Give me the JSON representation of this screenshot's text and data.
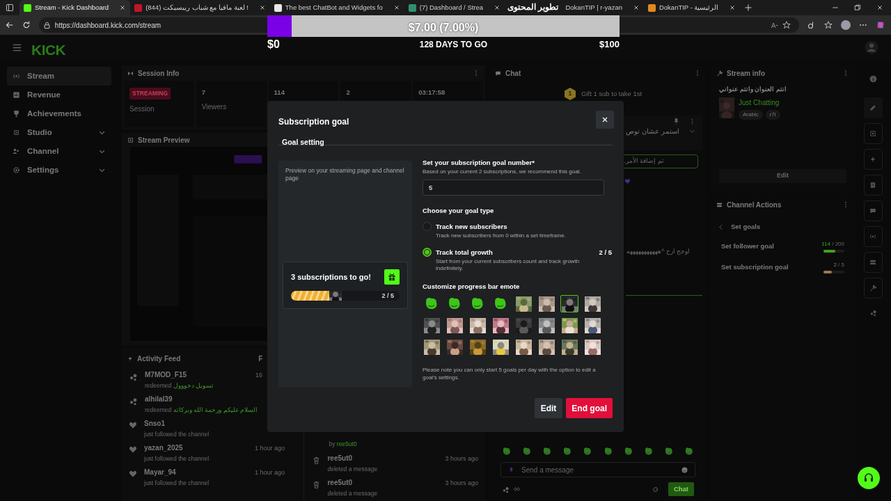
{
  "browser": {
    "tabs": [
      {
        "title": "Stream - Kick Dashboard",
        "selected": true,
        "color": "#53fc18"
      },
      {
        "title": "(844) لعبة مافيا مع شباب ريبسيكت !",
        "selected": false,
        "color": "#c4142b"
      },
      {
        "title": "The best ChatBot and Widgets fo",
        "selected": false,
        "color": "#e8e8e8"
      },
      {
        "title": "(7) Dashboard / Strea",
        "selected": false,
        "color": "#2f8f6f"
      },
      {
        "title": "DokanTIP | r-yazan",
        "selected": false
      },
      {
        "title": "DokanTIP - الرئيسية",
        "selected": false,
        "color": "#e08a1e"
      }
    ],
    "url": "https://dashboard.kick.com/stream"
  },
  "overlay": {
    "caption": "تطوير المحتوى",
    "goal": {
      "level": 0.07,
      "amount": "$7.00 (7.00%)",
      "start": "$0",
      "remaining": "128 DAYS TO GO",
      "target": "$100"
    }
  },
  "header": {
    "logo": "KICK"
  },
  "sidebar": [
    {
      "label": "Stream",
      "selected": true,
      "expandable": false
    },
    {
      "label": "Revenue",
      "selected": false,
      "expandable": false
    },
    {
      "label": "Achievements",
      "selected": false,
      "expandable": false
    },
    {
      "label": "Studio",
      "selected": false,
      "expandable": true
    },
    {
      "label": "Channel",
      "selected": false,
      "expandable": true
    },
    {
      "label": "Settings",
      "selected": false,
      "expandable": true
    }
  ],
  "session_info": {
    "title": "Session Info",
    "status": "STREAMING",
    "stats": [
      {
        "label": "Session"
      },
      {
        "value": "7",
        "label": "Viewers"
      },
      {
        "value": "114"
      },
      {
        "value": "2"
      },
      {
        "value": "03:17:58"
      }
    ]
  },
  "stream_preview": {
    "title": "Stream Preview"
  },
  "activity_feed": {
    "title": "Activity Feed",
    "filter": "F",
    "items": [
      {
        "kind": "redeem",
        "user": "M7MOD_F15",
        "detail": "redeemed",
        "reward": "تسويل دخووول",
        "time": "16"
      },
      {
        "kind": "redeem",
        "user": "alhilal39",
        "detail": "redeemed",
        "reward": "السلام عليكم ورحمة الله وبركاته"
      },
      {
        "kind": "follow",
        "user": "Snso1",
        "detail": "just followed the channel"
      },
      {
        "kind": "follow",
        "user": "yazan_2025",
        "detail": "just followed the channel",
        "time": "1 hour ago"
      },
      {
        "kind": "follow",
        "user": "Mayar_94",
        "detail": "just followed the channel",
        "time": "1 hour ago"
      }
    ]
  },
  "moderation_feed": {
    "items": [
      {
        "kind": "note",
        "detail": "by",
        "reward": "ree5ut0"
      },
      {
        "kind": "delete",
        "user": "ree5ut0",
        "detail": "deleted a message",
        "time": "3 hours ago"
      },
      {
        "kind": "delete",
        "user": "ree5ut0",
        "detail": "deleted a message",
        "time": "3 hours ago"
      }
    ]
  },
  "chat": {
    "title": "Chat",
    "gift_rank": "1",
    "gift_text": "Gift 1 sub to take 1st",
    "pinned": "استمر عشان توص",
    "notice": "تم إضافة الأمر.",
    "message": "اوجح ارح ^هههههههههههه",
    "placeholder": "Send a message",
    "send": "Chat"
  },
  "stream_info": {
    "title": "Stream info",
    "stream_title": "انتم العنوان وانتم عنواني",
    "category": "Just Chatting",
    "tags": [
      "Arabic",
      "r7l"
    ],
    "edit": "Edit"
  },
  "channel_actions": {
    "title": "Channel Actions",
    "back": "Set goals",
    "goals": [
      {
        "label": "Set follower goal",
        "current": "114",
        "target": "/ 200",
        "level": 0.57,
        "color": "#3fa21a"
      },
      {
        "label": "Set subscription goal",
        "current": "2",
        "target": "/ 5",
        "level": 0.4,
        "color": "#9a7a4a"
      }
    ]
  },
  "modal": {
    "title": "Subscription goal",
    "tab": "Goal setting",
    "preview_caption": "Preview on your streaming page and channel page",
    "preview_text": "3 subscriptions to go!",
    "preview_bar": {
      "level": 0.4
    },
    "preview_count": "2 / 5",
    "goal_label": "Set your subscription goal number*",
    "goal_hint": "Based on your current 2 subscriptions, we recommend this goal.",
    "goal_value": "5",
    "type_label": "Choose your goal type",
    "types": [
      {
        "title": "Track new subscribers",
        "description": "Track new subscribers from 0 within a set timeframe.",
        "selected": false
      },
      {
        "title": "Track total growth",
        "description": "Start from your current subscribers count and track growth indefinitely.",
        "selected": true,
        "count": "2 / 5"
      }
    ],
    "emote_label": "Customize progress bar emote",
    "emotes": [
      {
        "kind": "icon",
        "selected": false
      },
      {
        "kind": "icon",
        "selected": false
      },
      {
        "kind": "icon",
        "selected": false
      },
      {
        "kind": "icon",
        "selected": false
      },
      {
        "kind": "picture",
        "selected": false
      },
      {
        "kind": "picture",
        "selected": false
      },
      {
        "kind": "picture",
        "selected": true
      },
      {
        "kind": "picture",
        "selected": false
      },
      {
        "kind": "picture",
        "selected": false
      },
      {
        "kind": "picture",
        "selected": false
      },
      {
        "kind": "picture",
        "selected": false
      },
      {
        "kind": "picture",
        "selected": false
      },
      {
        "kind": "picture",
        "selected": false
      },
      {
        "kind": "picture",
        "selected": false
      },
      {
        "kind": "picture",
        "selected": false
      },
      {
        "kind": "picture",
        "selected": false
      },
      {
        "kind": "picture",
        "selected": false
      },
      {
        "kind": "picture",
        "selected": false
      },
      {
        "kind": "picture",
        "selected": false
      },
      {
        "kind": "picture",
        "selected": false
      },
      {
        "kind": "picture",
        "selected": false
      },
      {
        "kind": "picture",
        "selected": false
      },
      {
        "kind": "picture",
        "selected": false
      },
      {
        "kind": "picture",
        "selected": false
      }
    ],
    "note": "Please note you can only start 5 goals per day with the option to edit a goal's settings.",
    "edit": "Edit",
    "end": "End goal"
  }
}
